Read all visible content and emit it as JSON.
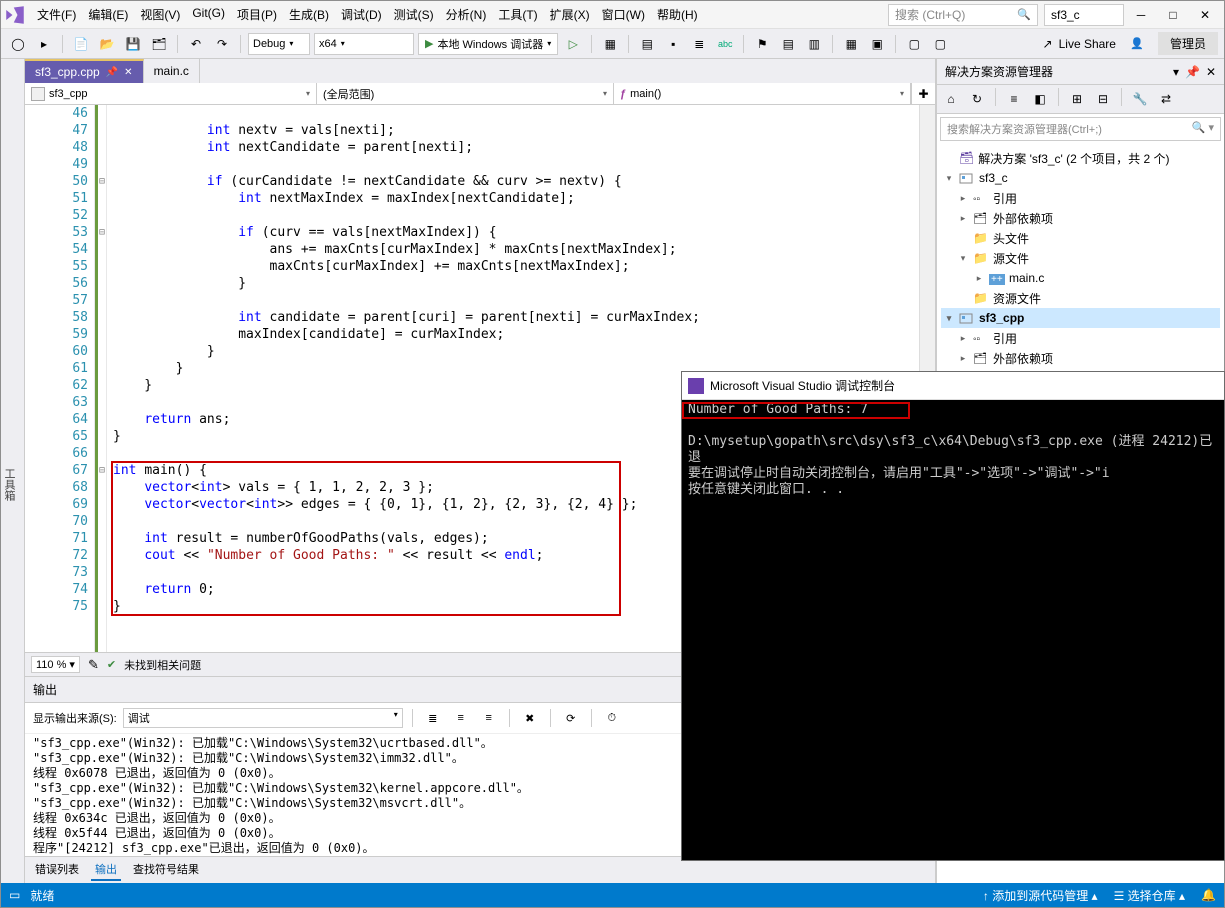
{
  "menus": [
    "文件(F)",
    "编辑(E)",
    "视图(V)",
    "Git(G)",
    "项目(P)",
    "生成(B)",
    "调试(D)",
    "测试(S)",
    "分析(N)",
    "工具(T)",
    "扩展(X)",
    "窗口(W)",
    "帮助(H)"
  ],
  "search_placeholder": "搜索 (Ctrl+Q)",
  "app_title": "sf3_c",
  "toolbar": {
    "config": "Debug",
    "platform": "x64",
    "run": "本地 Windows 调试器",
    "liveshare": "Live Share",
    "admin": "管理员"
  },
  "left_strip": "工具箱",
  "tabs": [
    {
      "name": "sf3_cpp.cpp",
      "active": true,
      "pinned": true
    },
    {
      "name": "main.c",
      "active": false
    }
  ],
  "ctx": {
    "scope": "sf3_cpp",
    "scope2": "(全局范围)",
    "func": "main()"
  },
  "zoom": "110 %",
  "no_issues": "未找到相关问题",
  "lines_start": 46,
  "code": [
    "",
    "            int nextv = vals[nexti];",
    "            int nextCandidate = parent[nexti];",
    "",
    "            if (curCandidate != nextCandidate && curv >= nextv) {",
    "                int nextMaxIndex = maxIndex[nextCandidate];",
    "",
    "                if (curv == vals[nextMaxIndex]) {",
    "                    ans += maxCnts[curMaxIndex] * maxCnts[nextMaxIndex];",
    "                    maxCnts[curMaxIndex] += maxCnts[nextMaxIndex];",
    "                }",
    "",
    "                int candidate = parent[curi] = parent[nexti] = curMaxIndex;",
    "                maxIndex[candidate] = curMaxIndex;",
    "            }",
    "        }",
    "    }",
    "",
    "    return ans;",
    "}",
    "",
    "int main() {",
    "    vector<int> vals = { 1, 1, 2, 2, 3 };",
    "    vector<vector<int>> edges = { {0, 1}, {1, 2}, {2, 3}, {2, 4} };",
    "",
    "    int result = numberOfGoodPaths(vals, edges);",
    "    cout << \"Number of Good Paths: \" << result << endl;",
    "",
    "    return 0;",
    "}"
  ],
  "output": {
    "title": "输出",
    "source_label": "显示输出来源(S):",
    "source_value": "调试",
    "lines": [
      "\"sf3_cpp.exe\"(Win32): 已加载\"C:\\Windows\\System32\\ucrtbased.dll\"。",
      "\"sf3_cpp.exe\"(Win32): 已加载\"C:\\Windows\\System32\\imm32.dll\"。",
      "线程 0x6078 已退出，返回值为 0 (0x0)。",
      "\"sf3_cpp.exe\"(Win32): 已加载\"C:\\Windows\\System32\\kernel.appcore.dll\"。",
      "\"sf3_cpp.exe\"(Win32): 已加载\"C:\\Windows\\System32\\msvcrt.dll\"。",
      "线程 0x634c 已退出，返回值为 0 (0x0)。",
      "线程 0x5f44 已退出，返回值为 0 (0x0)。",
      "程序\"[24212] sf3_cpp.exe\"已退出，返回值为 0 (0x0)。"
    ],
    "tabs": [
      "错误列表",
      "输出",
      "查找符号结果"
    ]
  },
  "se": {
    "title": "解决方案资源管理器",
    "search": "搜索解决方案资源管理器(Ctrl+;)",
    "sol": "解决方案 'sf3_c' (2 个项目，共 2 个)",
    "tree": [
      {
        "lvl": 0,
        "caret": "▾",
        "icon": "sol",
        "label": "",
        "bold": false
      },
      {
        "lvl": 0,
        "caret": "▾",
        "icon": "proj",
        "label": "sf3_c",
        "bold": false
      },
      {
        "lvl": 1,
        "caret": "▸",
        "icon": "ref",
        "label": "引用",
        "bold": false
      },
      {
        "lvl": 1,
        "caret": "▸",
        "icon": "ext",
        "label": "外部依赖项",
        "bold": false
      },
      {
        "lvl": 1,
        "caret": "",
        "icon": "folder",
        "label": "头文件",
        "bold": false
      },
      {
        "lvl": 1,
        "caret": "▾",
        "icon": "folder",
        "label": "源文件",
        "bold": false
      },
      {
        "lvl": 2,
        "caret": "▸",
        "icon": "c",
        "label": "main.c",
        "bold": false
      },
      {
        "lvl": 1,
        "caret": "",
        "icon": "folder",
        "label": "资源文件",
        "bold": false
      },
      {
        "lvl": 0,
        "caret": "▾",
        "icon": "proj",
        "label": "sf3_cpp",
        "bold": true,
        "sel": true
      },
      {
        "lvl": 1,
        "caret": "▸",
        "icon": "ref",
        "label": "引用",
        "bold": false
      },
      {
        "lvl": 1,
        "caret": "▸",
        "icon": "ext",
        "label": "外部依赖项",
        "bold": false
      }
    ]
  },
  "status": {
    "left": "就绪",
    "repo": "添加到源代码管理",
    "select": "选择仓库"
  },
  "console": {
    "title": "Microsoft Visual Studio 调试控制台",
    "result": "Number of Good Paths: 7",
    "path": "D:\\mysetup\\gopath\\src\\dsy\\sf3_c\\x64\\Debug\\sf3_cpp.exe (进程 24212)已退",
    "hint1": "要在调试停止时自动关闭控制台，请启用\"工具\"->\"选项\"->\"调试\"->\"i",
    "hint2": "按任意键关闭此窗口. . ."
  }
}
